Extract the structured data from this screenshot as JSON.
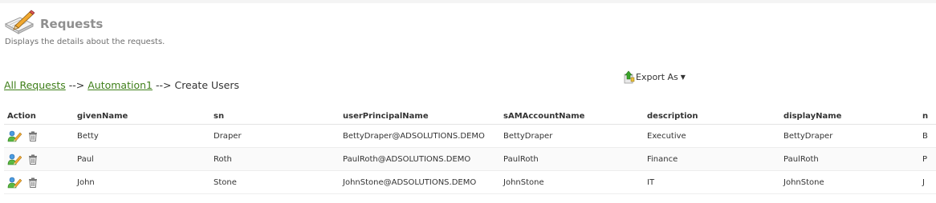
{
  "header": {
    "title": "Requests",
    "subtitle": "Displays the details about the requests.",
    "icon": "notepad-pencil-icon"
  },
  "breadcrumb": {
    "items": [
      "All Requests",
      "Automation1"
    ],
    "separator": "-->",
    "current": "Create Users"
  },
  "export": {
    "label": "Export As",
    "icon": "export-icon"
  },
  "table": {
    "columns": [
      "Action",
      "givenName",
      "sn",
      "userPrincipalName",
      "sAMAccountName",
      "description",
      "displayName",
      "n"
    ],
    "rows": [
      {
        "givenName": "Betty",
        "sn": "Draper",
        "userPrincipalName": "BettyDraper@ADSOLUTIONS.DEMO",
        "sAMAccountName": "BettyDraper",
        "description": "Executive",
        "displayName": "BettyDraper",
        "n": "B"
      },
      {
        "givenName": "Paul",
        "sn": "Roth",
        "userPrincipalName": "PaulRoth@ADSOLUTIONS.DEMO",
        "sAMAccountName": "PaulRoth",
        "description": "Finance",
        "displayName": "PaulRoth",
        "n": "P"
      },
      {
        "givenName": "John",
        "sn": "Stone",
        "userPrincipalName": "JohnStone@ADSOLUTIONS.DEMO",
        "sAMAccountName": "JohnStone",
        "description": "IT",
        "displayName": "JohnStone",
        "n": "J"
      }
    ],
    "row_actions": [
      "edit-user-icon",
      "trash-icon"
    ]
  },
  "colors": {
    "link": "#3f7f1a",
    "title": "#8f8f8f"
  }
}
